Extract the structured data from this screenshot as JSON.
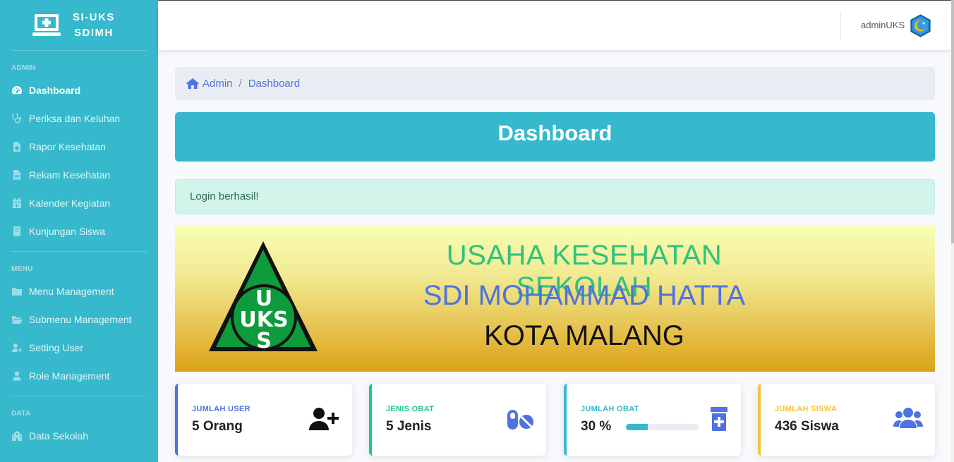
{
  "brand": {
    "line1": "SI-UKS",
    "line2": "SDIMH"
  },
  "sidebar": {
    "sections": [
      {
        "heading": "ADMIN",
        "items": [
          {
            "label": "Dashboard",
            "icon": "tachometer-icon",
            "active": true
          },
          {
            "label": "Periksa dan Keluhan",
            "icon": "stethoscope-icon"
          },
          {
            "label": "Rapor Kesehatan",
            "icon": "file-medical-icon"
          },
          {
            "label": "Rekam Kesehatan",
            "icon": "file-alt-icon"
          },
          {
            "label": "Kalender Kegiatan",
            "icon": "calendar-icon"
          },
          {
            "label": "Kunjungan Siswa",
            "icon": "book-icon"
          }
        ]
      },
      {
        "heading": "MENU",
        "items": [
          {
            "label": "Menu Management",
            "icon": "folder-icon"
          },
          {
            "label": "Submenu Management",
            "icon": "folder-open-icon"
          },
          {
            "label": "Setting User",
            "icon": "user-cog-icon"
          },
          {
            "label": "Role Management",
            "icon": "user-icon"
          }
        ]
      },
      {
        "heading": "DATA",
        "items": [
          {
            "label": "Data Sekolah",
            "icon": "school-icon"
          }
        ]
      }
    ]
  },
  "topbar": {
    "user_name": "adminUKS"
  },
  "breadcrumb": {
    "home": "Admin",
    "separator": "/",
    "current": "Dashboard"
  },
  "page_title": "Dashboard",
  "alert": {
    "message": "Login berhasil!"
  },
  "banner": {
    "line1": "USAHA KESEHATAN SEKOLAH",
    "line2": "SDI MOHAMMAD HATTA",
    "line3": "KOTA MALANG",
    "logo_letters": [
      "U",
      "UKS",
      "S"
    ]
  },
  "cards": [
    {
      "label": "JUMLAH USER",
      "value": "5 Orang",
      "color": "#4e73df",
      "icon": "user-plus-icon"
    },
    {
      "label": "JENIS OBAT",
      "value": "5 Jenis",
      "color": "#1cc88a",
      "icon": "pills-icon"
    },
    {
      "label": "JUMLAH OBAT",
      "value": "30 %",
      "color": "#36b9cc",
      "icon": "prescription-bottle-icon",
      "progress_percent": 30
    },
    {
      "label": "JUMLAH SISWA",
      "value": "436 Siswa",
      "color": "#f6c23e",
      "icon": "users-icon"
    }
  ]
}
